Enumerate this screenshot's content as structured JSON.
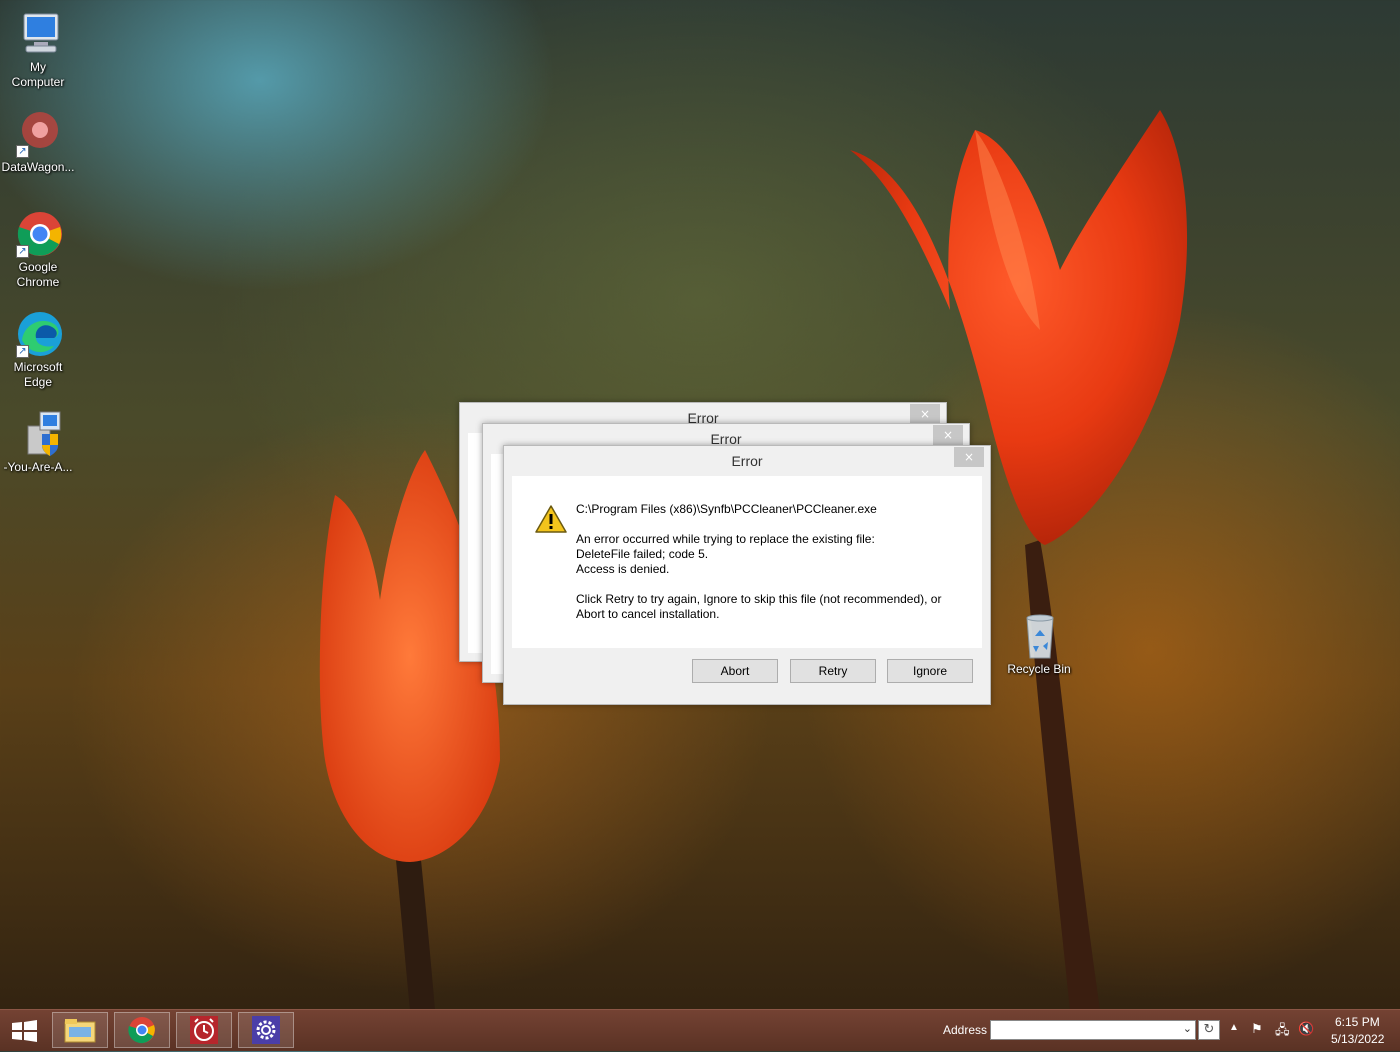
{
  "desktop": {
    "icons": [
      {
        "label_line1": "My",
        "label_line2": "Computer"
      },
      {
        "label_line1": "DataWagon..."
      },
      {
        "label_line1": "Google",
        "label_line2": "Chrome"
      },
      {
        "label_line1": "Microsoft",
        "label_line2": "Edge"
      },
      {
        "label_line1": "-You-Are-A..."
      },
      {
        "label_line1": "Recycle Bin"
      }
    ]
  },
  "dialogs": {
    "back_title": "Error",
    "middle_title": "Error",
    "front": {
      "title": "Error",
      "close_glyph": "×",
      "path": "C:\\Program Files (x86)\\Synfb\\PCCleaner\\PCCleaner.exe",
      "line1": "An error occurred while trying to replace the existing file:",
      "line2": "DeleteFile failed; code 5.",
      "line3": "Access is denied.",
      "line4": "Click Retry to try again, Ignore to skip this file (not recommended), or",
      "line5": "Abort to cancel installation.",
      "buttons": {
        "abort": "Abort",
        "retry": "Retry",
        "ignore": "Ignore"
      }
    }
  },
  "taskbar": {
    "address_label": "Address",
    "address_value": "",
    "time": "6:15 PM",
    "date": "5/13/2022"
  },
  "colors": {
    "taskbar": "#6b3a2c",
    "tulip": "#e8401a",
    "warning": "#f3c41c"
  }
}
